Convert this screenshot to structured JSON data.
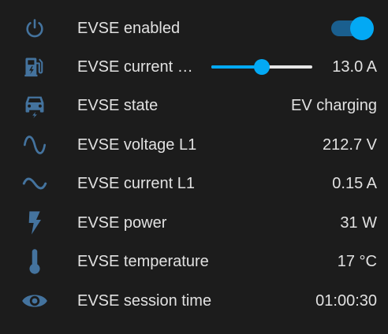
{
  "theme": {
    "icon_color": "#44739e",
    "accent": "#03a9f4",
    "text": "#e1e1e1",
    "background": "#1c1c1c"
  },
  "rows": [
    {
      "icon": "power-icon",
      "label": "EVSE enabled",
      "control": "toggle",
      "enabled": true
    },
    {
      "icon": "ev-station-icon",
      "label": "EVSE current …",
      "control": "slider",
      "slider_fraction": 0.5,
      "value": "13.0 A"
    },
    {
      "icon": "car-electric-icon",
      "label": "EVSE state",
      "value": "EV charging"
    },
    {
      "icon": "sine-wave-icon",
      "label": "EVSE voltage L1",
      "value": "212.7 V"
    },
    {
      "icon": "current-ac-icon",
      "label": "EVSE current L1",
      "value": "0.15 A"
    },
    {
      "icon": "flash-icon",
      "label": "EVSE power",
      "value": "31 W"
    },
    {
      "icon": "thermometer-icon",
      "label": "EVSE temperature",
      "value": "17 °C"
    },
    {
      "icon": "eye-icon",
      "label": "EVSE session time",
      "value": "01:00:30"
    }
  ]
}
